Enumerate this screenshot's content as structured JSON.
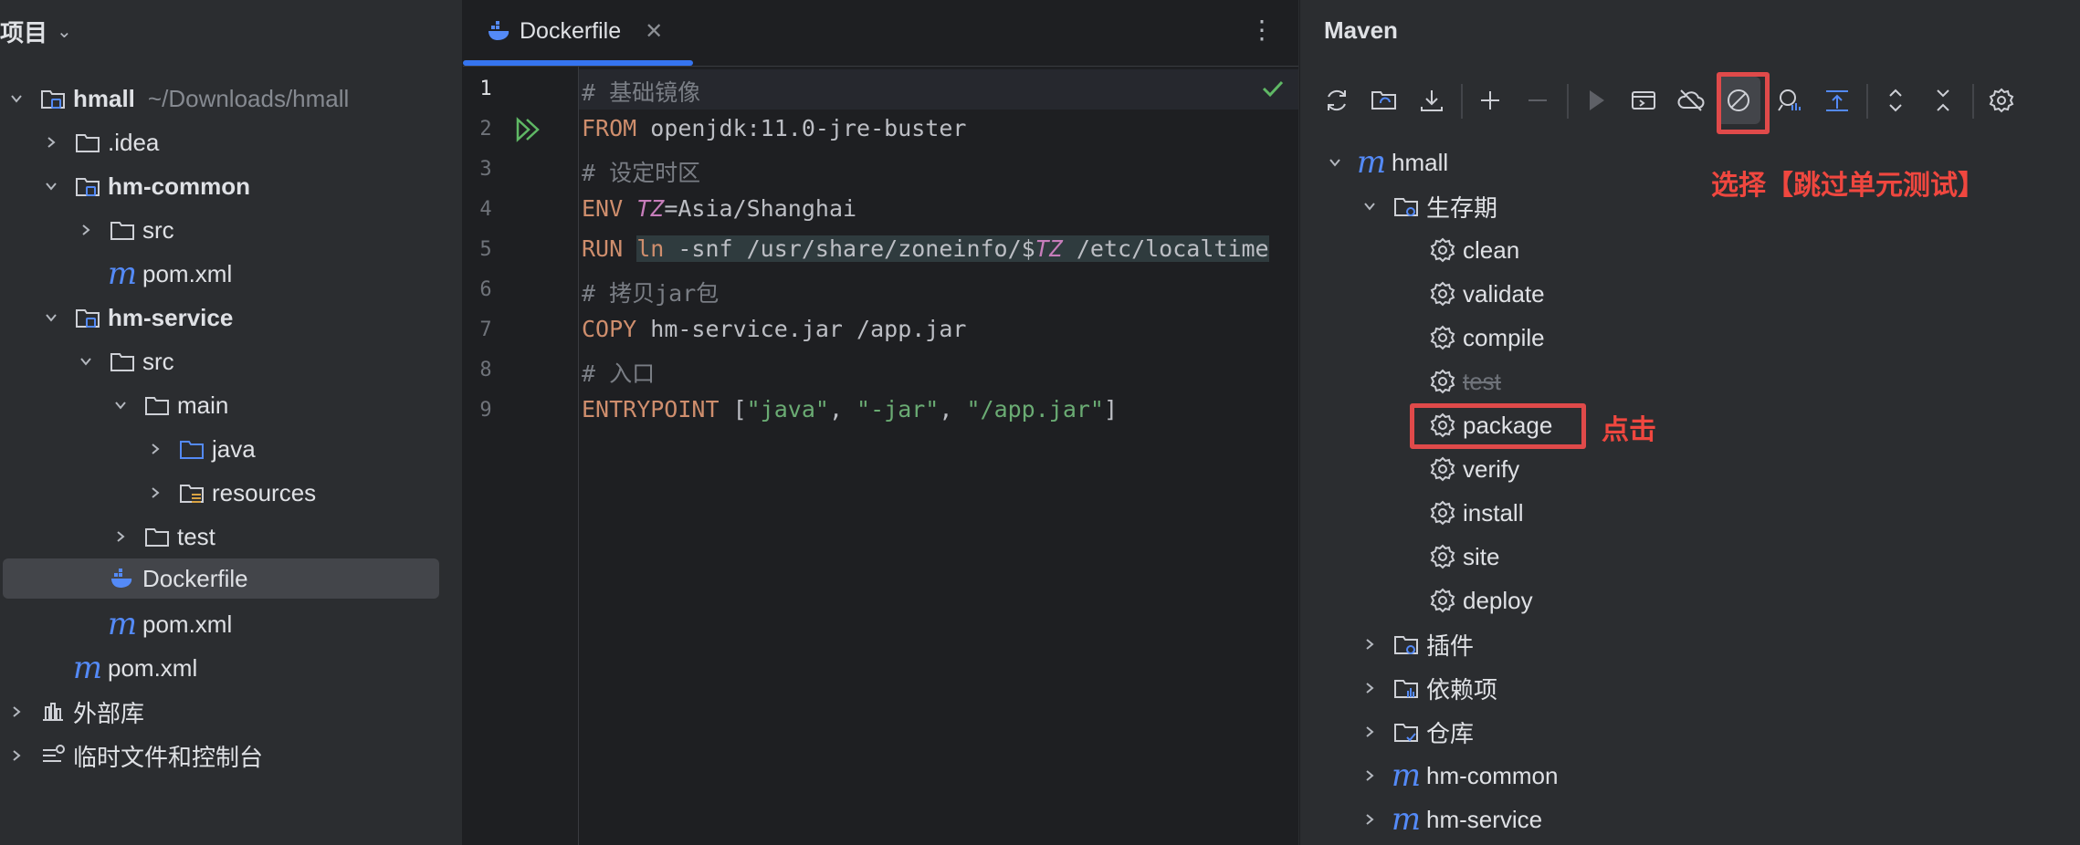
{
  "project": {
    "header": "项目",
    "tree": [
      {
        "label": "hmall",
        "path": "~/Downloads/hmall"
      },
      {
        "label": ".idea"
      },
      {
        "label": "hm-common"
      },
      {
        "label": "src"
      },
      {
        "label": "pom.xml"
      },
      {
        "label": "hm-service"
      },
      {
        "label": "src"
      },
      {
        "label": "main"
      },
      {
        "label": "java"
      },
      {
        "label": "resources"
      },
      {
        "label": "test"
      },
      {
        "label": "Dockerfile"
      },
      {
        "label": "pom.xml"
      },
      {
        "label": "pom.xml"
      },
      {
        "label": "外部库"
      },
      {
        "label": "临时文件和控制台"
      }
    ]
  },
  "editor": {
    "tab": "Dockerfile",
    "lines": [
      "1",
      "2",
      "3",
      "4",
      "5",
      "6",
      "7",
      "8",
      "9"
    ],
    "code": {
      "l1": "# 基础镜像",
      "l2_kw": "FROM",
      "l2_rest": " openjdk:11.0-jre-buster",
      "l3": "# 设定时区",
      "l4_kw": "ENV",
      "l4_var": "TZ",
      "l4_rest": "=Asia/Shanghai",
      "l5_kw": "RUN",
      "l5_cmd": "ln",
      "l5_a": " -snf /usr/share/zoneinfo/$",
      "l5_var": "TZ",
      "l5_b": " /etc/localtime",
      "l6": "# 拷贝jar包",
      "l7_kw": "COPY",
      "l7_rest": " hm-service.jar /app.jar",
      "l8": "# 入口",
      "l9_kw": "ENTRYPOINT",
      "l9_s1": "\"java\"",
      "l9_s2": "\"-jar\"",
      "l9_s3": "\"/app.jar\""
    }
  },
  "maven": {
    "title": "Maven",
    "tree": {
      "root": "hmall",
      "lifecycle": "生存期",
      "goals": [
        "clean",
        "validate",
        "compile",
        "test",
        "package",
        "verify",
        "install",
        "site",
        "deploy"
      ],
      "plugins": "插件",
      "dependencies": "依赖项",
      "repositories": "仓库",
      "module1": "hm-common",
      "module2": "hm-service"
    },
    "annotations": {
      "skip_tests": "选择【跳过单元测试】",
      "click": "点击"
    }
  },
  "colors": {
    "accent": "#3574f0",
    "annotation": "#f0473f",
    "maven_m": "#548af7"
  }
}
